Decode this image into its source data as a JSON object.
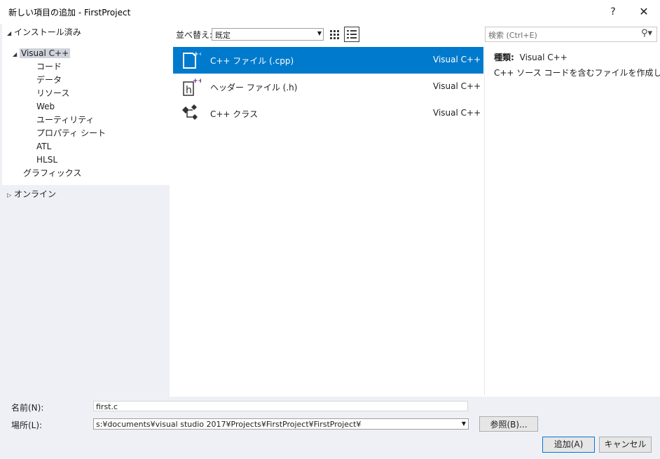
{
  "window": {
    "title": "新しい項目の追加 - FirstProject",
    "help": "?",
    "close": "✕"
  },
  "tree": {
    "installed": "インストール済み",
    "visual_cpp": "Visual C++",
    "children": [
      "コード",
      "データ",
      "リソース",
      "Web",
      "ユーティリティ",
      "プロパティ シート",
      "ATL",
      "HLSL"
    ],
    "graphics": "グラフィックス",
    "online": "オンライン"
  },
  "toolbar": {
    "sort_label": "並べ替え:",
    "sort_value": "既定",
    "search_placeholder": "検索 (Ctrl+E)"
  },
  "templates": [
    {
      "name": "C++ ファイル (.cpp)",
      "type": "Visual C++",
      "icon": "cpp-file-icon"
    },
    {
      "name": "ヘッダー ファイル (.h)",
      "type": "Visual C++",
      "icon": "header-file-icon"
    },
    {
      "name": "C++ クラス",
      "type": "Visual C++",
      "icon": "cpp-class-icon"
    }
  ],
  "details": {
    "kind_label": "種類:",
    "kind_value": "Visual C++",
    "description": "C++ ソース コードを含むファイルを作成します"
  },
  "form": {
    "name_label": "名前(N):",
    "name_value": "first.c",
    "location_label": "場所(L):",
    "location_value": "s:¥documents¥visual studio 2017¥Projects¥FirstProject¥FirstProject¥",
    "browse": "参照(B)...",
    "add": "追加(A)",
    "cancel": "キャンセル"
  },
  "colors": {
    "selected": "#007acc",
    "pane_bg": "#eef0f6",
    "accent_purple": "#68217a"
  }
}
